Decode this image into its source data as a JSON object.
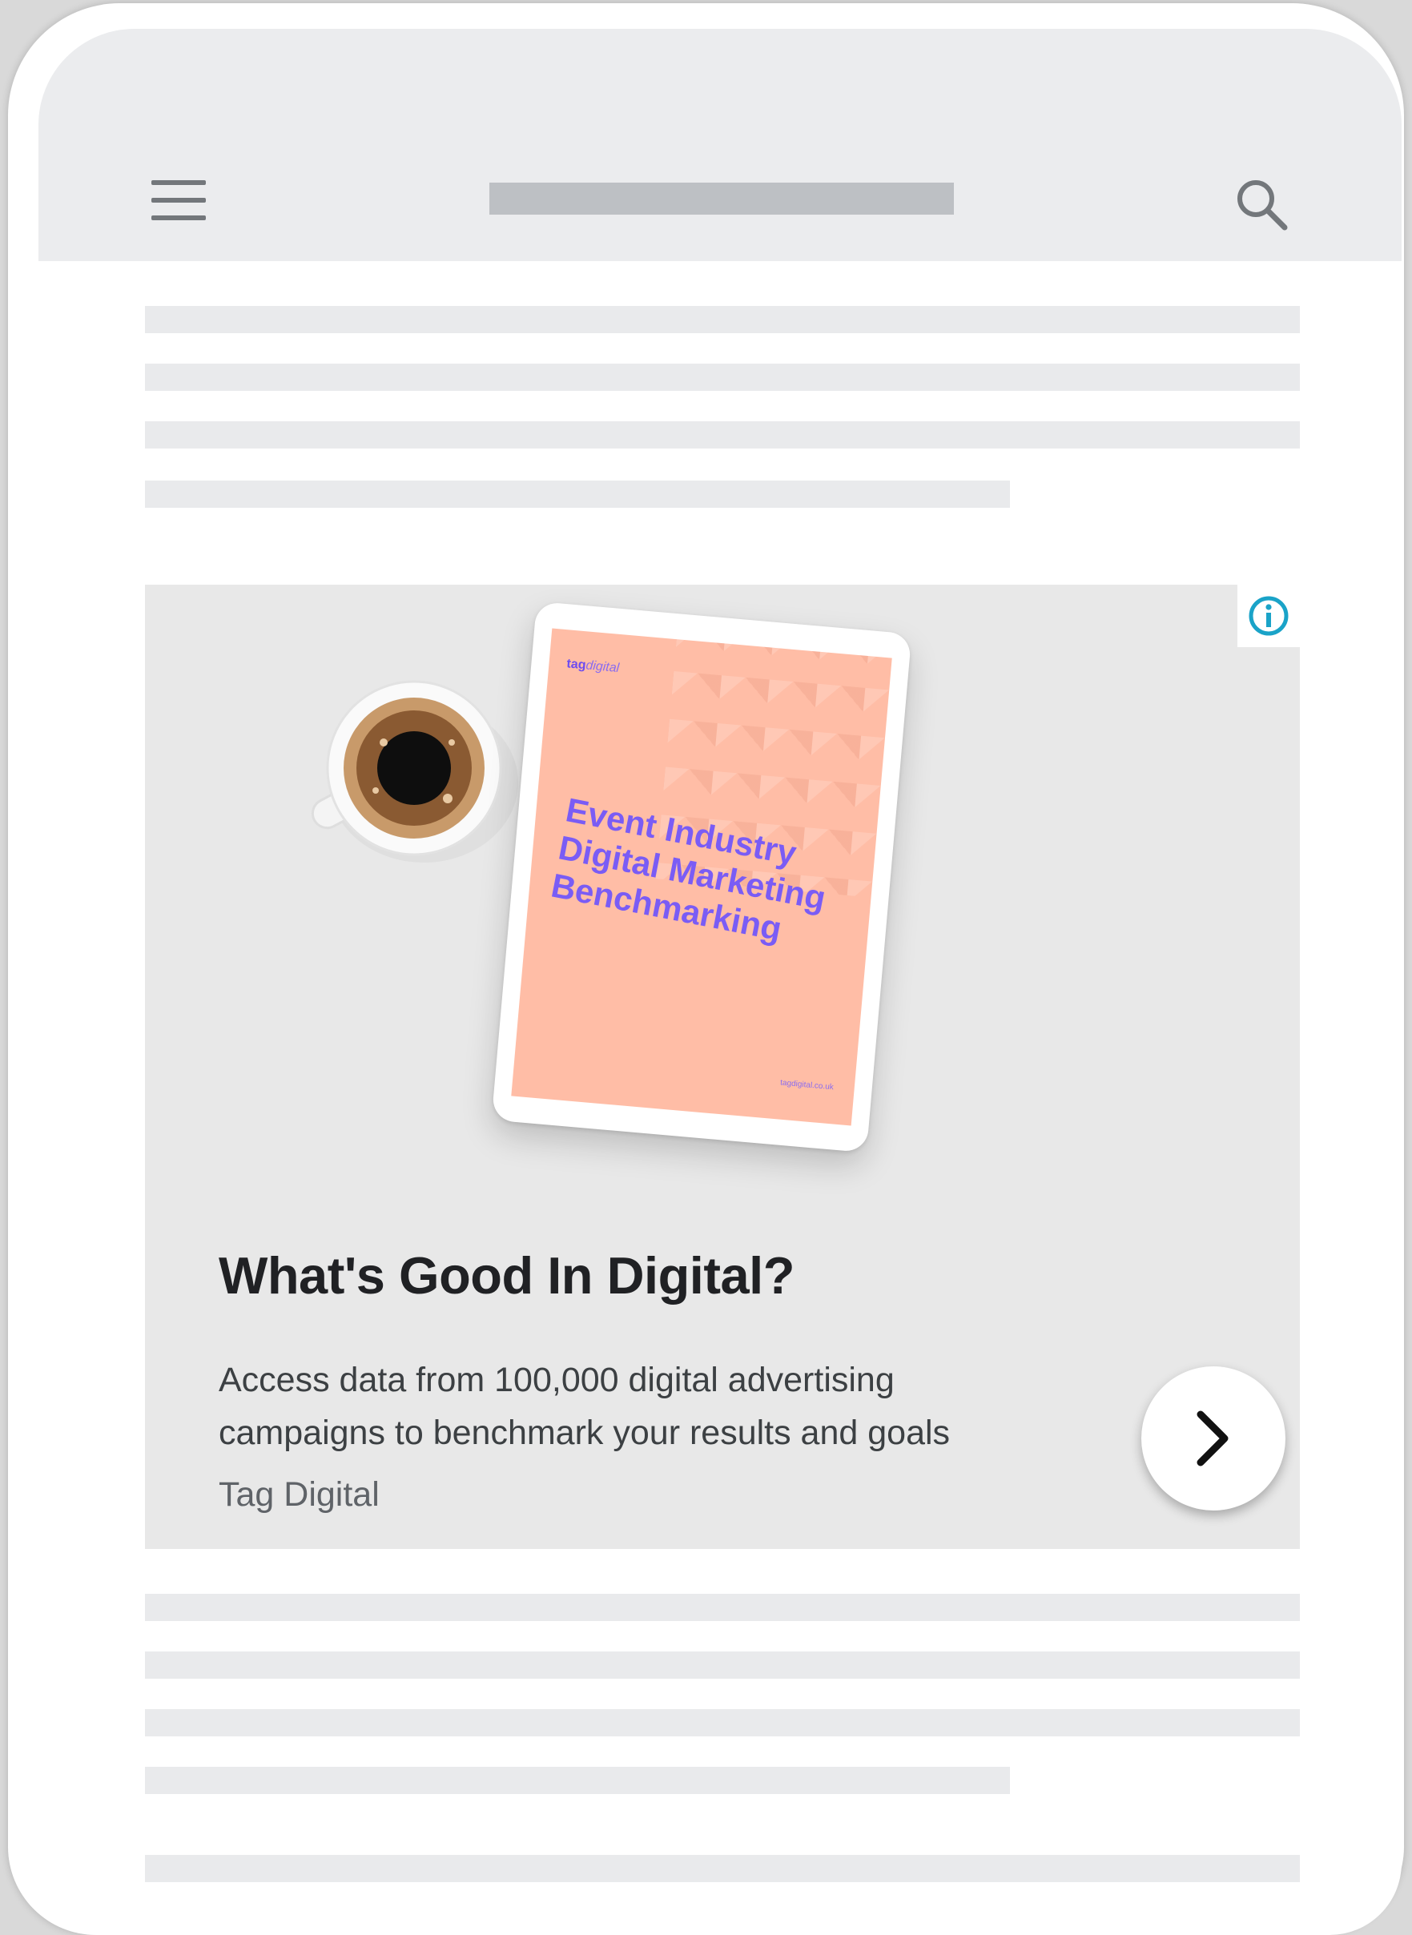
{
  "ad": {
    "headline": "What's Good In Digital?",
    "description": "Access data from 100,000 digital advertising campaigns to benchmark your results and goals",
    "advertiser": "Tag Digital",
    "info_icon": "info-icon",
    "cta_icon": "chevron-right-icon",
    "creative": {
      "brand_bold": "tag",
      "brand_light": "digital",
      "title": "Event Industry Digital Marketing Benchmarking",
      "url": "tagdigital.co.uk"
    }
  },
  "app_bar": {
    "menu_icon": "hamburger-menu-icon",
    "search_icon": "search-icon"
  },
  "colors": {
    "app_bar": "#ebecee",
    "placeholder_line": "#e9eaec",
    "ad_background": "#e8e8e8",
    "info_accent": "#1aa3c8",
    "creative_background": "#ffbda6",
    "creative_text": "#7a5cf5"
  }
}
